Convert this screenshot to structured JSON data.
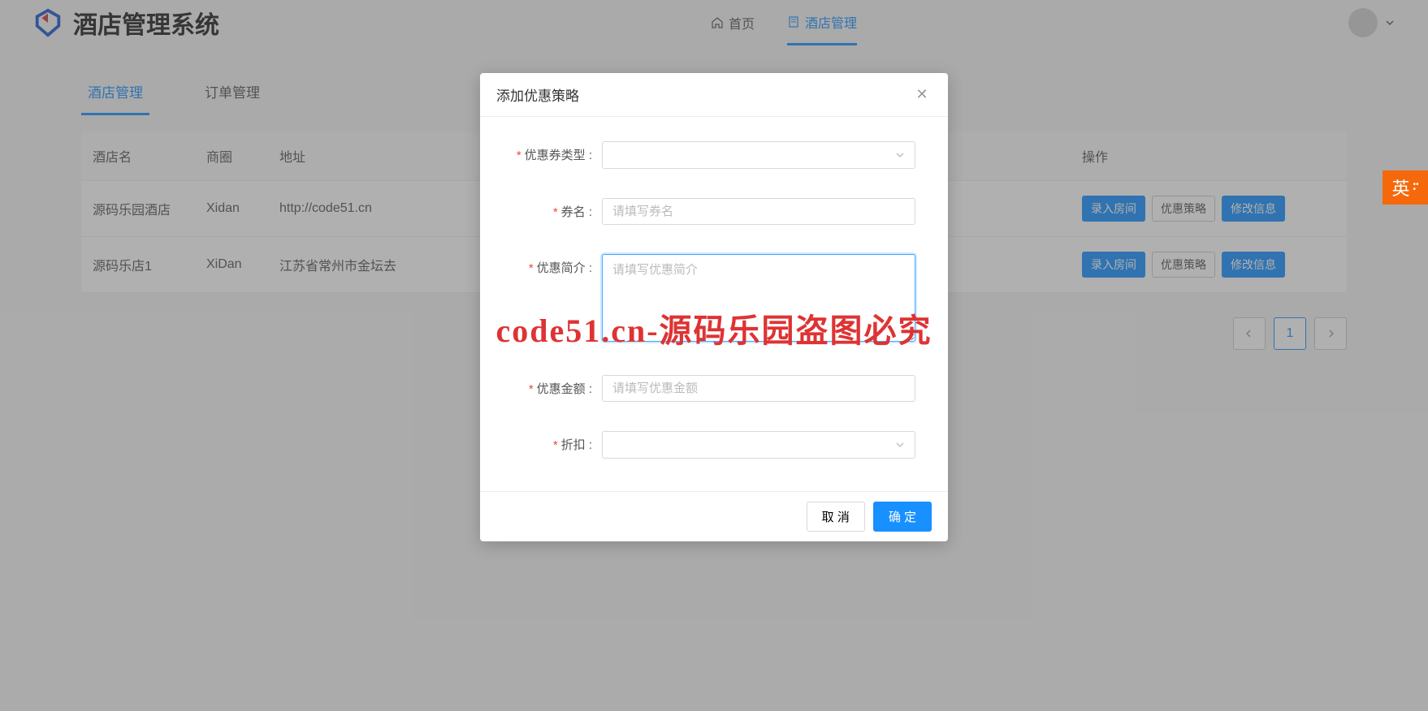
{
  "header": {
    "title": "酒店管理系统",
    "nav": {
      "home": "首页",
      "hotel_mgmt": "酒店管理"
    }
  },
  "tabs": {
    "hotel": "酒店管理",
    "order": "订单管理"
  },
  "table": {
    "headers": {
      "name": "酒店名",
      "area": "商圈",
      "address": "地址",
      "action": "操作"
    },
    "rows": [
      {
        "name": "源码乐园酒店",
        "area": "Xidan",
        "address": "http://code51.cn"
      },
      {
        "name": "源码乐店1",
        "area": "XiDan",
        "address": "江苏省常州市金坛去"
      }
    ],
    "actions": {
      "room": "录入房间",
      "strategy": "优惠策略",
      "edit": "修改信息"
    }
  },
  "pagination": {
    "page1": "1"
  },
  "modal": {
    "title": "添加优惠策略",
    "fields": {
      "coupon_type": "优惠券类型 :",
      "coupon_name": "券名 :",
      "coupon_name_ph": "请填写券名",
      "intro": "优惠简介 :",
      "intro_ph": "请填写优惠简介",
      "amount": "优惠金额 :",
      "amount_ph": "请填写优惠金额",
      "discount": "折扣 :"
    },
    "cancel": "取 消",
    "confirm": "确 定"
  },
  "watermark": "code51.cn-源码乐园盗图必究",
  "ime": "英"
}
